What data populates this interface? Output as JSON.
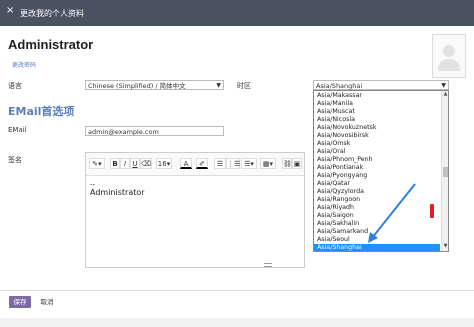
{
  "dialog": {
    "title": "更改我的个人资料",
    "close_icon": "×"
  },
  "user": {
    "name": "Administrator",
    "change_password": "更改密码"
  },
  "form": {
    "language_label": "语言",
    "language_value": "Chinese (Simplified) / 简体中文",
    "timezone_label": "时区",
    "timezone_value": "Asia/Shanghai",
    "email_heading": "EMail首选项",
    "email_label": "EMail",
    "email_value": "admin@example.com",
    "signature_label": "签名"
  },
  "editor": {
    "toolbar": {
      "magic": "✎▾",
      "bold": "B",
      "italic": "I",
      "underline": "U",
      "eraser": "⌫",
      "font_size": "16▾",
      "font_color": "A",
      "highlight": "✐",
      "unordered_list": "☰",
      "ordered_list": "⋮☰",
      "align": "☰▾",
      "table": "▦▾",
      "link": "⛓",
      "picture": "▣"
    },
    "content_line1": "--",
    "content_line2": "Administrator"
  },
  "timezone_dropdown": {
    "items": [
      "Asia/Makassar",
      "Asia/Manila",
      "Asia/Muscat",
      "Asia/Nicosia",
      "Asia/Novokuznetsk",
      "Asia/Novosibirsk",
      "Asia/Omsk",
      "Asia/Oral",
      "Asia/Phnom_Penh",
      "Asia/Pontianak",
      "Asia/Pyongyang",
      "Asia/Qatar",
      "Asia/Qyzylorda",
      "Asia/Rangoon",
      "Asia/Riyadh",
      "Asia/Saigon",
      "Asia/Sakhalin",
      "Asia/Samarkand",
      "Asia/Seoul",
      "Asia/Shanghai"
    ],
    "selected": "Asia/Shanghai"
  },
  "footer": {
    "save": "保存",
    "cancel": "取消"
  },
  "colors": {
    "titlebar": "#4b5161",
    "accent": "#7b69a8",
    "heading_blue": "#5b7fb5",
    "selected_row": "#1e90ff",
    "arrow": "#2f7fd8",
    "red_mark": "#e0202a"
  }
}
